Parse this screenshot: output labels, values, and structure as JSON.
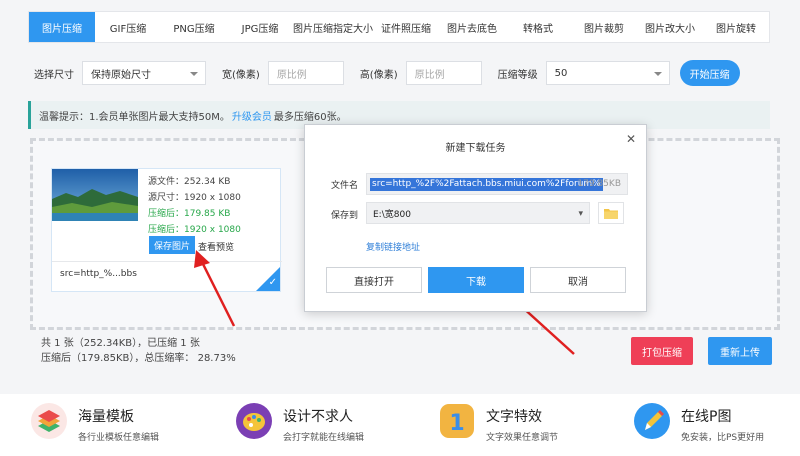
{
  "tabs": [
    "图片压缩",
    "GIF压缩",
    "PNG压缩",
    "JPG压缩",
    "图片压缩指定大小",
    "证件照压缩",
    "图片去底色",
    "转格式",
    "图片裁剪",
    "图片改大小",
    "图片旋转"
  ],
  "options": {
    "size_label": "选择尺寸",
    "size_value": "保持原始尺寸",
    "width_label": "宽(像素)",
    "width_placeholder": "原比例",
    "height_label": "高(像素)",
    "height_placeholder": "原比例",
    "level_label": "压缩等级",
    "level_value": "50",
    "start_button": "开始压缩"
  },
  "notice": {
    "prefix": "温馨提示：1.会员单张图片最大支持50M。",
    "link": "升级会员",
    "suffix": "最多压缩60张。"
  },
  "file_card": {
    "source_file": "源文件：252.34 KB",
    "source_size": "源尺寸：1920 x 1080",
    "compressed_file": "压缩后：179.85 KB",
    "compressed_size": "压缩后：1920 x 1080",
    "save_button": "保存图片",
    "preview_link": "查看预览",
    "filename": "src=http_%...bbs"
  },
  "stats": {
    "line1": "共 1 张（252.34KB），已压缩 1 张",
    "line2": "压缩后（179.85KB），总压缩率： 28.73%",
    "pack_button": "打包压缩",
    "reupload_button": "重新上传"
  },
  "features": [
    {
      "title": "海量模板",
      "desc": "各行业模板任意编辑",
      "icon": "layers-icon"
    },
    {
      "title": "设计不求人",
      "desc": "会打字就能在线编辑",
      "icon": "palette-icon"
    },
    {
      "title": "文字特效",
      "desc": "文字效果任意调节",
      "icon": "number-one-icon"
    },
    {
      "title": "在线P图",
      "desc": "免安装，比PS更好用",
      "icon": "pencil-icon"
    }
  ],
  "dialog": {
    "title": "新建下载任务",
    "filename_label": "文件名",
    "filename_value": "src=http_%2F%2Fattach.bbs.miui.com%2Fforum%",
    "file_size": "179.85KB",
    "save_to_label": "保存到",
    "save_to_value": "E:\\宽800",
    "copy_link": "复制链接地址",
    "open_button": "直接打开",
    "download_button": "下载",
    "cancel_button": "取消"
  },
  "colors": {
    "accent": "#2f97f0",
    "danger": "#ef3f57",
    "success": "#27a74a"
  }
}
